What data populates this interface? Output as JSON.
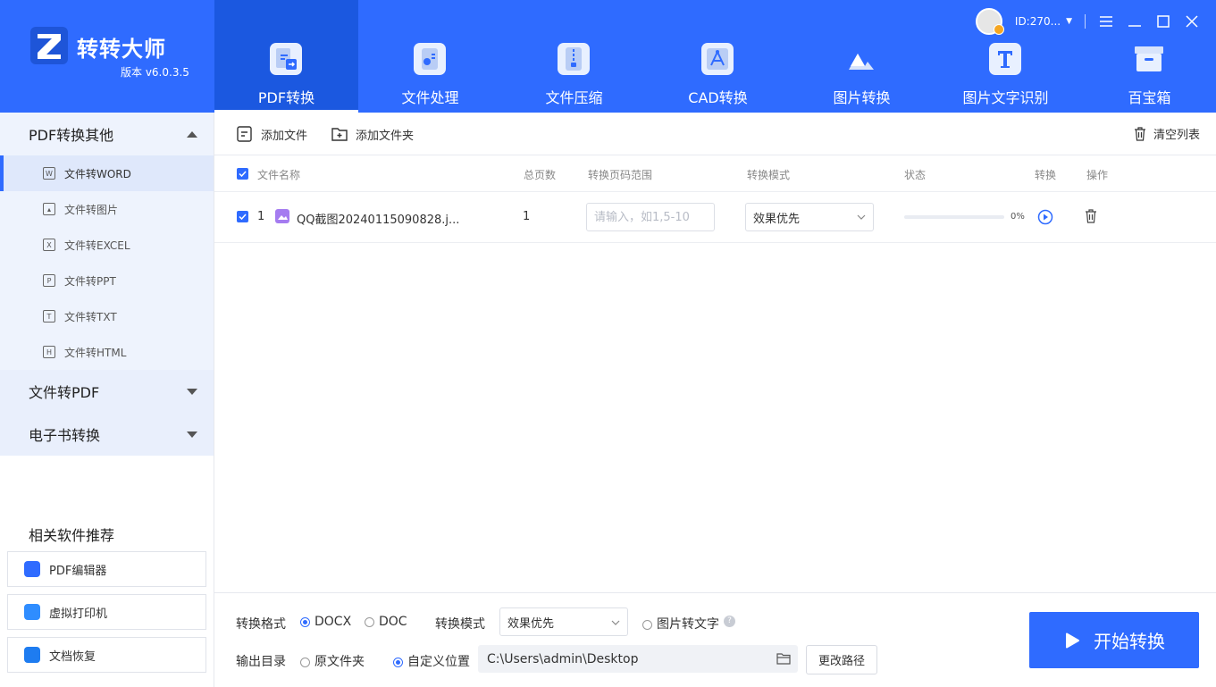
{
  "app": {
    "title": "转转大师",
    "version": "版本 v6.0.3.5",
    "brand_color": "#2f6bff",
    "user_id": "ID:270...",
    "window_controls": [
      "menu-icon",
      "minimize-icon",
      "maximize-icon",
      "close-icon"
    ]
  },
  "nav": {
    "tabs": [
      {
        "label": "PDF转换",
        "icon": "pdf-convert-icon",
        "active": true
      },
      {
        "label": "文件处理",
        "icon": "file-process-icon",
        "active": false
      },
      {
        "label": "文件压缩",
        "icon": "compress-icon",
        "active": false
      },
      {
        "label": "CAD转换",
        "icon": "cad-icon",
        "active": false
      },
      {
        "label": "图片转换",
        "icon": "image-convert-icon",
        "active": false
      },
      {
        "label": "图片文字识别",
        "icon": "ocr-icon",
        "active": false
      },
      {
        "label": "百宝箱",
        "icon": "toolbox-icon",
        "active": false
      }
    ]
  },
  "sidebar": {
    "sections": [
      {
        "label": "PDF转换其他",
        "expanded": true
      },
      {
        "label": "文件转PDF",
        "expanded": false
      },
      {
        "label": "电子书转换",
        "expanded": false
      }
    ],
    "items": [
      {
        "label": "文件转WORD",
        "icon": "W",
        "active": true
      },
      {
        "label": "文件转图片",
        "icon": "img",
        "active": false
      },
      {
        "label": "文件转EXCEL",
        "icon": "X",
        "active": false
      },
      {
        "label": "文件转PPT",
        "icon": "P",
        "active": false
      },
      {
        "label": "文件转TXT",
        "icon": "T",
        "active": false
      },
      {
        "label": "文件转HTML",
        "icon": "H",
        "active": false
      }
    ],
    "recommend_title": "相关软件推荐",
    "recommend": [
      {
        "label": "PDF编辑器",
        "color": "#2f6bff"
      },
      {
        "label": "虚拟打印机",
        "color": "#2f8dff"
      },
      {
        "label": "文档恢复",
        "color": "#1e7cf0"
      }
    ]
  },
  "toolbar": {
    "add_file": "添加文件",
    "add_folder": "添加文件夹",
    "clear_list": "清空列表"
  },
  "table": {
    "headers": {
      "name": "文件名称",
      "pages": "总页数",
      "range": "转换页码范围",
      "mode": "转换模式",
      "status": "状态",
      "convert": "转换",
      "action": "操作"
    },
    "rows": [
      {
        "index": "1",
        "name": "QQ截图20240115090828.j...",
        "pages": "1",
        "range_placeholder": "请输入，如1,5-10",
        "mode": "效果优先",
        "progress": 0,
        "progress_text": "0%"
      }
    ]
  },
  "bottom": {
    "format_label": "转换格式",
    "format_options": [
      {
        "label": "DOCX",
        "selected": true
      },
      {
        "label": "DOC",
        "selected": false
      }
    ],
    "mode_label": "转换模式",
    "mode_value": "效果优先",
    "ocr_option": "图片转文字",
    "output_label": "输出目录",
    "output_options": [
      {
        "label": "原文件夹",
        "selected": false
      },
      {
        "label": "自定义位置",
        "selected": true
      }
    ],
    "path": "C:\\Users\\admin\\Desktop",
    "change_path": "更改路径",
    "start": "开始转换"
  }
}
